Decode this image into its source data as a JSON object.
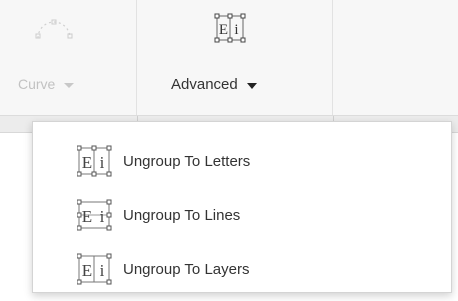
{
  "toolbar": {
    "curve": {
      "label": "Curve",
      "icon": "curve-text-icon",
      "state": "disabled"
    },
    "advanced": {
      "label": "Advanced",
      "icon": "ungroup-text-icon"
    }
  },
  "dropdown": {
    "items": [
      {
        "label": "Ungroup To Letters",
        "icon": "ungroup-letters-icon"
      },
      {
        "label": "Ungroup To Lines",
        "icon": "ungroup-lines-icon"
      },
      {
        "label": "Ungroup To Layers",
        "icon": "ungroup-layers-icon"
      }
    ]
  },
  "glyphs": {
    "ungroup_icon_text": "Ei"
  },
  "colors": {
    "disabled_text": "#c2c2c2",
    "text": "#333333",
    "icon_stroke": "#555555",
    "toolbar_bg": "#f7f7f7"
  }
}
